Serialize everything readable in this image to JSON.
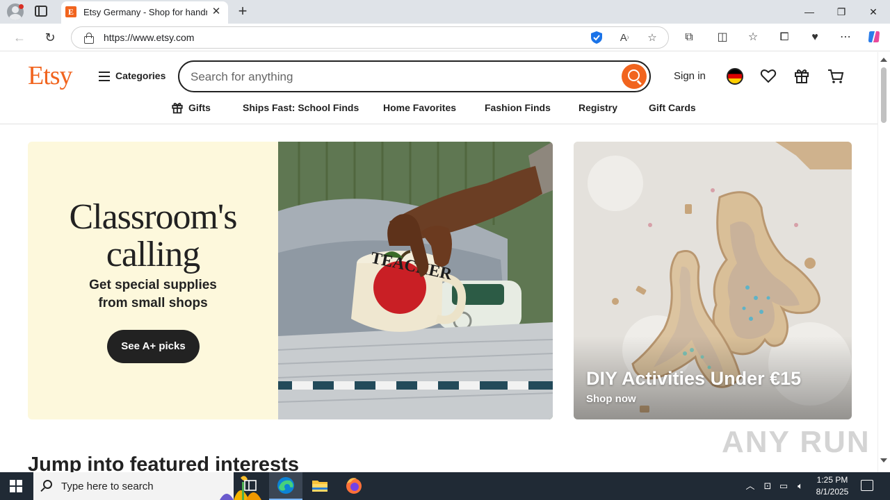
{
  "browser": {
    "tab_title": "Etsy Germany - Shop for handmade, vintage, custom, and unique gifts",
    "tab_favicon": "E",
    "tab_close": "✕",
    "new_tab": "+",
    "url": "https://www.etsy.com",
    "window_controls": {
      "minimize": "—",
      "restore": "❐",
      "close": "✕"
    }
  },
  "header": {
    "logo": "Etsy",
    "categories_label": "Categories",
    "search_placeholder": "Search for anything",
    "signin_label": "Sign in"
  },
  "category_nav": [
    {
      "label": "Gifts"
    },
    {
      "label": "Ships Fast: School Finds"
    },
    {
      "label": "Home Favorites"
    },
    {
      "label": "Fashion Finds"
    },
    {
      "label": "Registry"
    },
    {
      "label": "Gift Cards"
    }
  ],
  "hero": {
    "title_line1": "Classroom's",
    "title_line2": "calling",
    "subtitle_line1": "Get special supplies",
    "subtitle_line2": "from small shops",
    "button_label": "See A+ picks",
    "mug_text": "TEACHER"
  },
  "side_banner": {
    "title": "DIY Activities Under €15",
    "link": "Shop now"
  },
  "section": {
    "title": "Jump into featured interests"
  },
  "watermark": "ANY RUN",
  "taskbar": {
    "search_placeholder": "Type here to search",
    "time": "1:25 PM",
    "date": "8/1/2025"
  },
  "colors": {
    "brand": "#f1641e",
    "hero_bg": "#fdf8dc",
    "dark": "#222222"
  }
}
